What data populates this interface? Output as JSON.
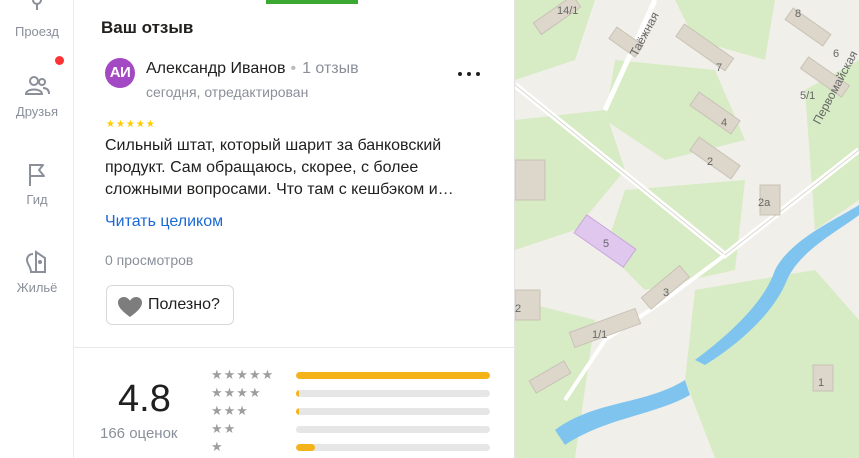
{
  "nav": {
    "items": [
      {
        "label": "Проезд",
        "icon": "route-icon"
      },
      {
        "label": "Друзья",
        "icon": "friends-icon"
      },
      {
        "label": "Гид",
        "icon": "guide-flag-icon"
      },
      {
        "label": "Жильё",
        "icon": "housing-icon"
      }
    ]
  },
  "review": {
    "section_title": "Ваш отзыв",
    "avatar_initials": "АИ",
    "author": "Александр Иванов",
    "review_count": "1 отзыв",
    "subtitle": "сегодня, отредактирован",
    "stars": "★★★★★",
    "text": "Сильный штат, который шарит за банковский продукт. Сам обращаюсь, скорее, с более сложными вопросами. Что там с кешбэком и…",
    "read_more": "Читать целиком",
    "views": "0 просмотров",
    "useful_label": "Полезно?"
  },
  "rating": {
    "value": "4.8",
    "count": "166 оценок",
    "distribution": [
      {
        "stars": "★★★★★",
        "share": 1.0
      },
      {
        "stars": "★★★★",
        "share": 0.01
      },
      {
        "stars": "★★★",
        "share": 0.01
      },
      {
        "stars": "★★",
        "share": 0.0
      },
      {
        "stars": "★",
        "share": 0.1
      }
    ]
  },
  "map": {
    "labels": [
      "14/1",
      "8",
      "6",
      "Таёжная",
      "7",
      "5/1",
      "4",
      "2",
      "Первомайская",
      "2а",
      "5",
      "3",
      "2",
      "1/1",
      "1"
    ]
  },
  "colors": {
    "accent_green": "#3aa831",
    "link_blue": "#1a69d6",
    "star_yellow": "#fc0",
    "bar_fill": "#f4b319",
    "avatar_purple": "#a349c4"
  }
}
